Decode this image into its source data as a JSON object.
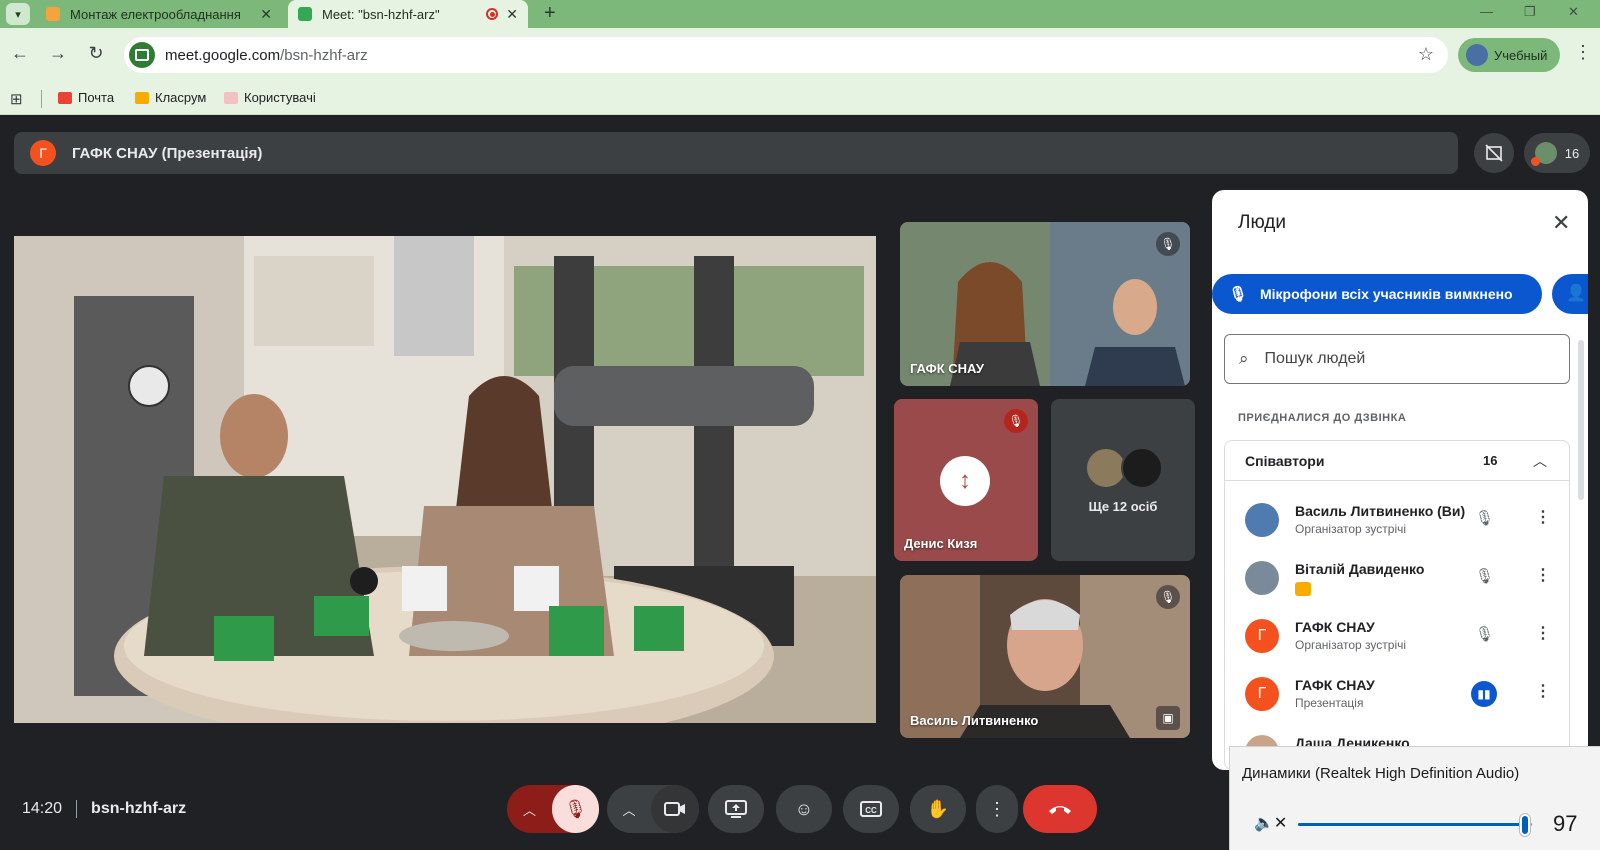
{
  "browser": {
    "tabs": [
      {
        "title": "Монтаж електрообладнання",
        "close": "✕",
        "active": false
      },
      {
        "title": "Meet: \"bsn-hzhf-arz\"",
        "close": "✕",
        "active": true
      }
    ],
    "url_host": "meet.google.com",
    "url_path": "/bsn-hzhf-arz",
    "profile_label": "Учебный",
    "bookmarks": [
      {
        "label": "Почта",
        "icon": "gmail-icon",
        "color": "#ea4335"
      },
      {
        "label": "Класрум",
        "icon": "classroom-icon",
        "color": "#f9ab00"
      },
      {
        "label": "Користувачі",
        "icon": "users-icon",
        "color": "#e8eaed"
      }
    ]
  },
  "meeting": {
    "presenter_initial": "Г",
    "presentation_title": "ГАФК СНАУ (Презентація)",
    "participant_count": "16",
    "time": "14:20",
    "code": "bsn-hzhf-arz"
  },
  "tiles": {
    "gafk_name": "ГАФК СНАУ",
    "denys_name": "Денис Кизя",
    "more_label": "Ще 12 осіб",
    "vasyl_name": "Василь Литвиненко"
  },
  "people_panel": {
    "title": "Люди",
    "mute_all_label": "Мікрофони всіх учасників вимкнено",
    "search_placeholder": "Пошук людей",
    "joined_header": "ПРИЄДНАЛИСЯ ДО ДЗВІНКА",
    "group_label": "Співавтори",
    "group_count": "16",
    "participants": [
      {
        "name": "Василь Литвиненко (Ви)",
        "role": "Організатор зустрічі"
      },
      {
        "name": "Віталій Давиденко",
        "role": ""
      },
      {
        "name": "ГАФК СНАУ",
        "role": "Організатор зустрічі",
        "initial": "Г"
      },
      {
        "name": "ГАФК СНАУ",
        "role": "Презентація",
        "initial": "Г"
      },
      {
        "name": "Даша Деникенко",
        "role": ""
      }
    ]
  },
  "volume": {
    "device": "Динамики (Realtek High Definition Audio)",
    "level": "97",
    "level_fraction": 0.97
  },
  "colors": {
    "tab_bar": "#7cb87a",
    "meet_bg": "#202124",
    "leave_red": "#dc362e",
    "accent_blue": "#0b57d0",
    "avatar_orange": "#f4511e"
  }
}
